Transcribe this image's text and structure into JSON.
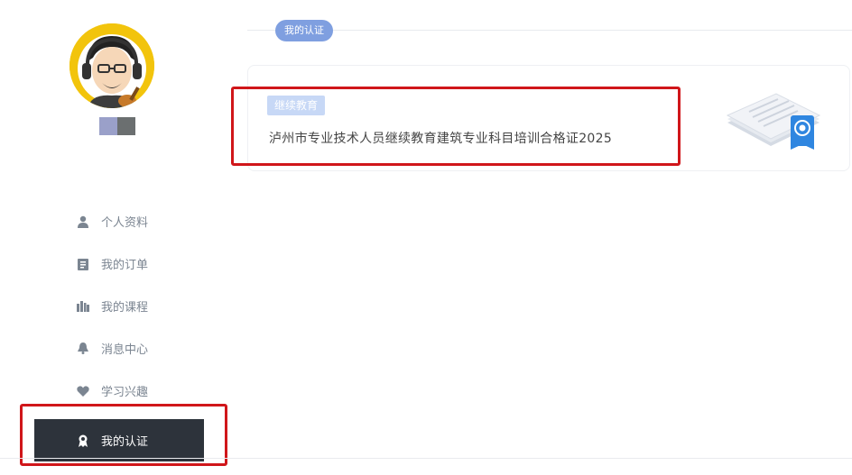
{
  "user": {
    "username_swatches": [
      "#9aa0c9",
      "#6b6f70"
    ]
  },
  "sidebar": {
    "items": [
      {
        "label": "个人资料",
        "icon": "person-icon"
      },
      {
        "label": "我的订单",
        "icon": "clipboard-icon"
      },
      {
        "label": "我的课程",
        "icon": "books-icon"
      },
      {
        "label": "消息中心",
        "icon": "bell-icon"
      },
      {
        "label": "学习兴趣",
        "icon": "heart-icon"
      },
      {
        "label": "我的认证",
        "icon": "badge-icon",
        "active": true
      }
    ]
  },
  "main": {
    "section_title": "我的认证",
    "certificate": {
      "tag": "继续教育",
      "title": "泸州市专业技术人员继续教育建筑专业科目培训合格证2025"
    }
  },
  "colors": {
    "active_bg": "#2d333b",
    "pill": "#7f9fe0",
    "tag": "#c7d8f6",
    "highlight": "#d0161a"
  }
}
